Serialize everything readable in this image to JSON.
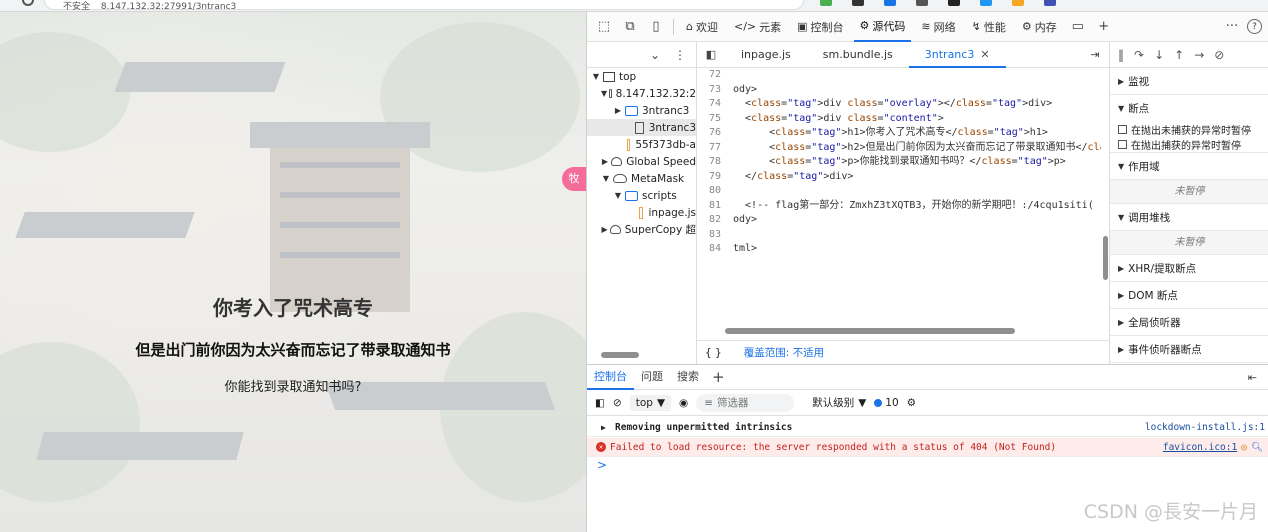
{
  "browser": {
    "security_label": "不安全",
    "url": "8.147.132.32:27991/3ntranc3"
  },
  "page": {
    "h1": "你考入了咒术高专",
    "h2": "但是出门前你因为太兴奋而忘记了带录取通知书",
    "p": "你能找到录取通知书吗?",
    "side_badge": "牧"
  },
  "devtools": {
    "tabs": [
      {
        "label": "欢迎",
        "icon": "home-icon"
      },
      {
        "label": "元素",
        "icon": "code-icon"
      },
      {
        "label": "控制台",
        "icon": "console-icon"
      },
      {
        "label": "源代码",
        "icon": "sources-icon"
      },
      {
        "label": "网络",
        "icon": "wifi-icon"
      },
      {
        "label": "性能",
        "icon": "performance-icon"
      },
      {
        "label": "内存",
        "icon": "memory-icon"
      }
    ],
    "more_label": "···",
    "help_label": "?",
    "navigator": {
      "rows": [
        {
          "label": "top",
          "kind": "window",
          "arrow": "▼",
          "indent": 4
        },
        {
          "label": "8.147.132.32:2",
          "kind": "cloud",
          "arrow": "▼",
          "indent": 14
        },
        {
          "label": "3ntranc3",
          "kind": "folder",
          "arrow": "▶",
          "indent": 26
        },
        {
          "label": "3ntranc3",
          "kind": "file",
          "arrow": "",
          "indent": 36
        },
        {
          "label": "55f373db-a",
          "kind": "file-js",
          "arrow": "",
          "indent": 36
        },
        {
          "label": "Global Speed",
          "kind": "cloud",
          "arrow": "▶",
          "indent": 14
        },
        {
          "label": "MetaMask",
          "kind": "cloud",
          "arrow": "▼",
          "indent": 14
        },
        {
          "label": "scripts",
          "kind": "folder",
          "arrow": "▼",
          "indent": 26
        },
        {
          "label": "inpage.js",
          "kind": "file-js",
          "arrow": "",
          "indent": 46
        },
        {
          "label": "SuperCopy 超",
          "kind": "cloud",
          "arrow": "▶",
          "indent": 14
        }
      ]
    },
    "editor": {
      "tabs": [
        "inpage.js",
        "sm.bundle.js",
        "3ntranc3"
      ],
      "lines": [
        {
          "n": "72",
          "html": ""
        },
        {
          "n": "73",
          "html": "ody>"
        },
        {
          "n": "74",
          "html": "  <div class=\"overlay\"></div>"
        },
        {
          "n": "75",
          "html": "  <div class=\"content\">"
        },
        {
          "n": "76",
          "html": "      <h1>你考入了咒术高专</h1>"
        },
        {
          "n": "77",
          "html": "      <h2>但是出门前你因为太兴奋而忘记了带录取通知书</h2>"
        },
        {
          "n": "78",
          "html": "      <p>你能找到录取通知书吗？</p>"
        },
        {
          "n": "79",
          "html": "  </div>"
        },
        {
          "n": "80",
          "html": ""
        },
        {
          "n": "81",
          "html": "  <!-- flag第一部分：ZmxhZ3tXQTB3，开始你的新学期吧！:/4cqu1siti("
        },
        {
          "n": "82",
          "html": "ody>"
        },
        {
          "n": "83",
          "html": ""
        },
        {
          "n": "84",
          "html": "tml>"
        }
      ],
      "status_braces": "{ }",
      "coverage": "覆盖范围: 不适用"
    },
    "debugger": {
      "watch": "监视",
      "breakpoints": "断点",
      "pause_uncaught": "在抛出未捕获的异常时暂停",
      "pause_caught": "在抛出捕获的异常时暂停",
      "scope": "作用域",
      "not_paused_1": "未暂停",
      "call_stack": "调用堆栈",
      "not_paused_2": "未暂停",
      "xhr": "XHR/提取断点",
      "dom": "DOM 断点",
      "global_listeners": "全局侦听器",
      "event_listeners": "事件侦听器断点"
    },
    "drawer": {
      "tabs": [
        "控制台",
        "问题",
        "搜索"
      ],
      "context": "top",
      "filter_placeholder": "筛选器",
      "level": "默认级别",
      "issues_count": "10"
    },
    "console": {
      "line1": {
        "msg": "Removing unpermitted intrinsics",
        "src": "lockdown-install.js:1"
      },
      "line2": {
        "msg": "Failed to load resource: the server responded with a status of 404 (Not Found)",
        "src": "favicon.ico:1"
      },
      "prompt": ">"
    }
  },
  "watermark": "CSDN @長安一片月"
}
